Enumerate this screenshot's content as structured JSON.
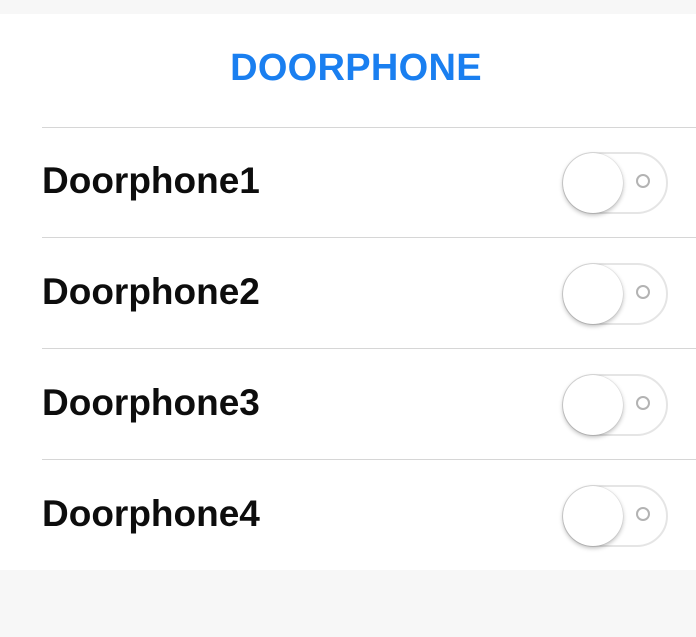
{
  "section": {
    "title": "DOORPHONE"
  },
  "doorphones": [
    {
      "label": "Doorphone1",
      "enabled": false
    },
    {
      "label": "Doorphone2",
      "enabled": false
    },
    {
      "label": "Doorphone3",
      "enabled": false
    },
    {
      "label": "Doorphone4",
      "enabled": false
    }
  ],
  "colors": {
    "accent": "#1a7ff0",
    "text": "#0d0d0d",
    "background": "#f7f7f7",
    "panel": "#ffffff",
    "divider": "#d6d6d6"
  }
}
